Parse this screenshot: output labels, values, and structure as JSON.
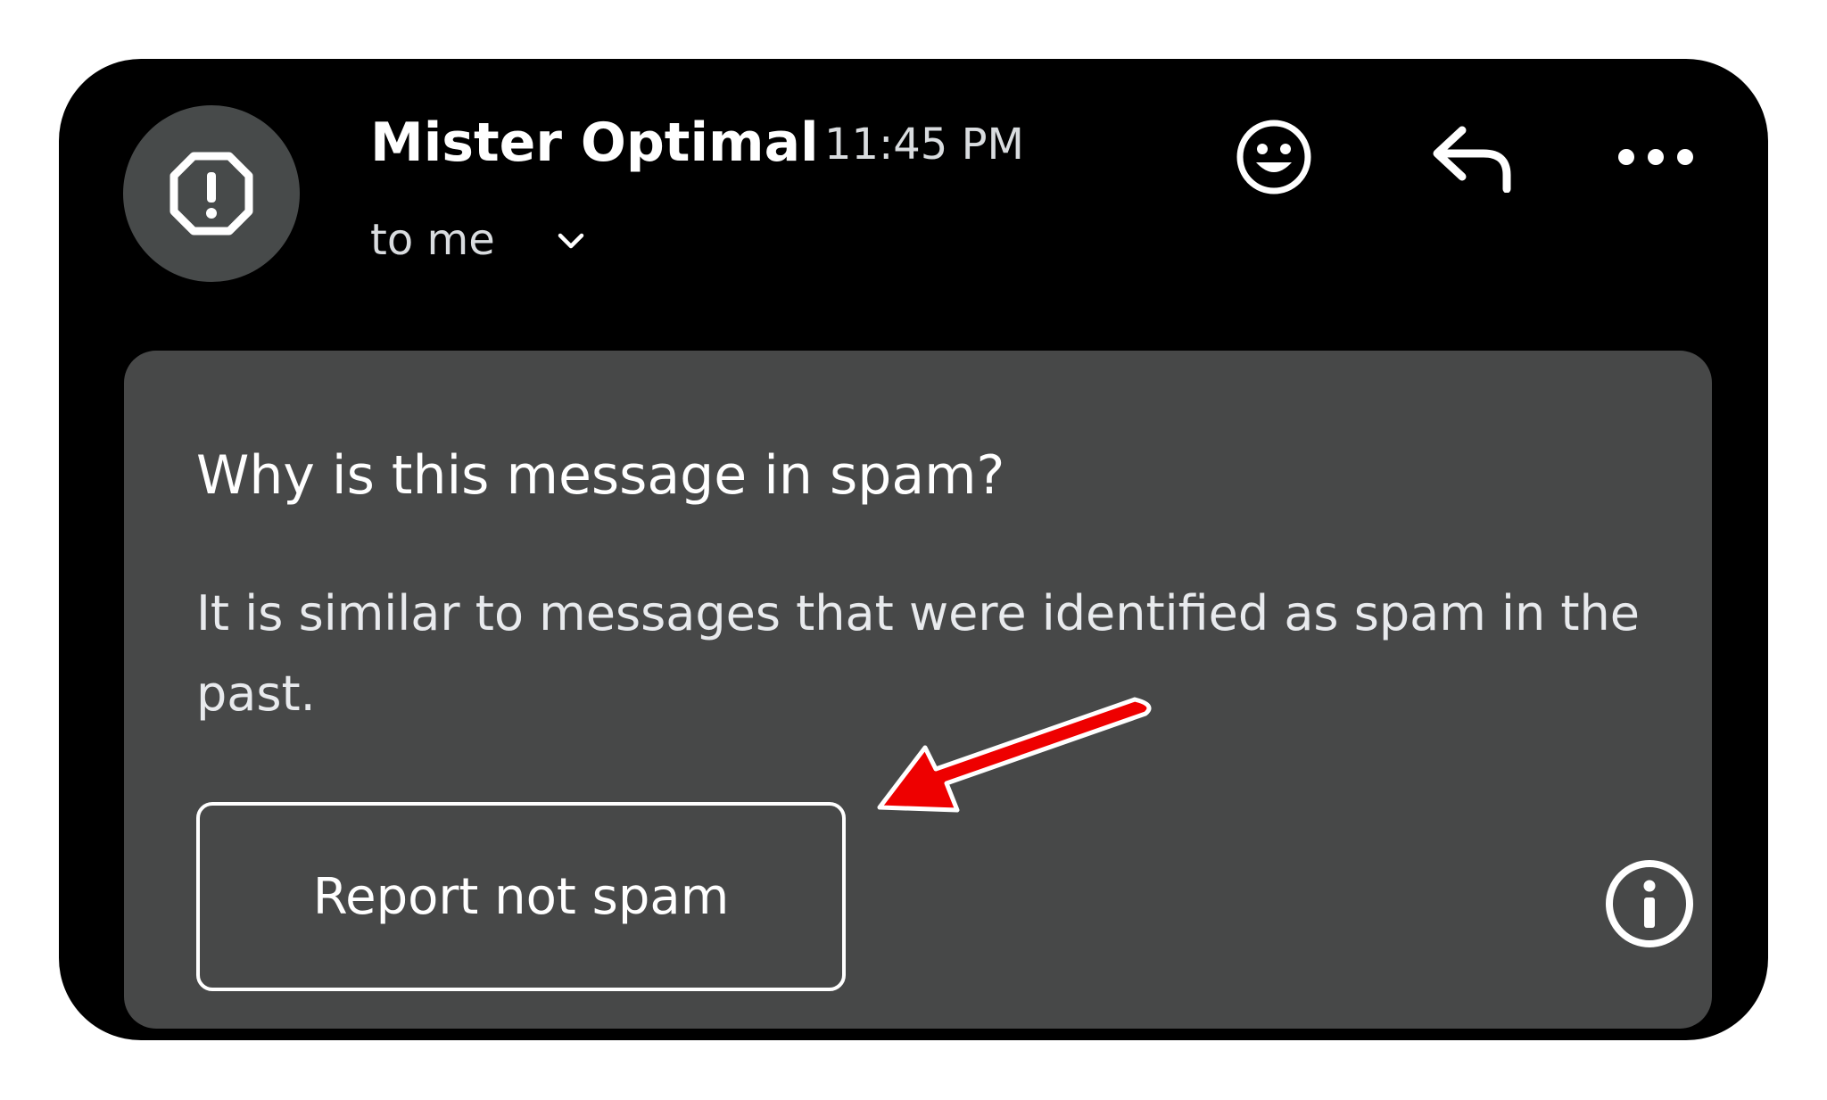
{
  "message_header": {
    "sender_name": "Mister Optimal",
    "timestamp": "11:45 PM",
    "recipient_label": "to me"
  },
  "icons": {
    "avatar": "warning-octagon-icon",
    "chevron": "chevron-down-icon",
    "emoji": "add-reaction-smiley-icon",
    "reply": "reply-icon",
    "more": "more-options-icon",
    "info": "info-icon"
  },
  "spam_notice": {
    "title": "Why is this message in spam?",
    "body": "It is similar to messages that were identified as spam in the past.",
    "report_button_label": "Report not spam"
  },
  "colors": {
    "background": "#000000",
    "panel": "#474848",
    "avatar": "#474a4a",
    "annotation_arrow": "#ee0000"
  }
}
